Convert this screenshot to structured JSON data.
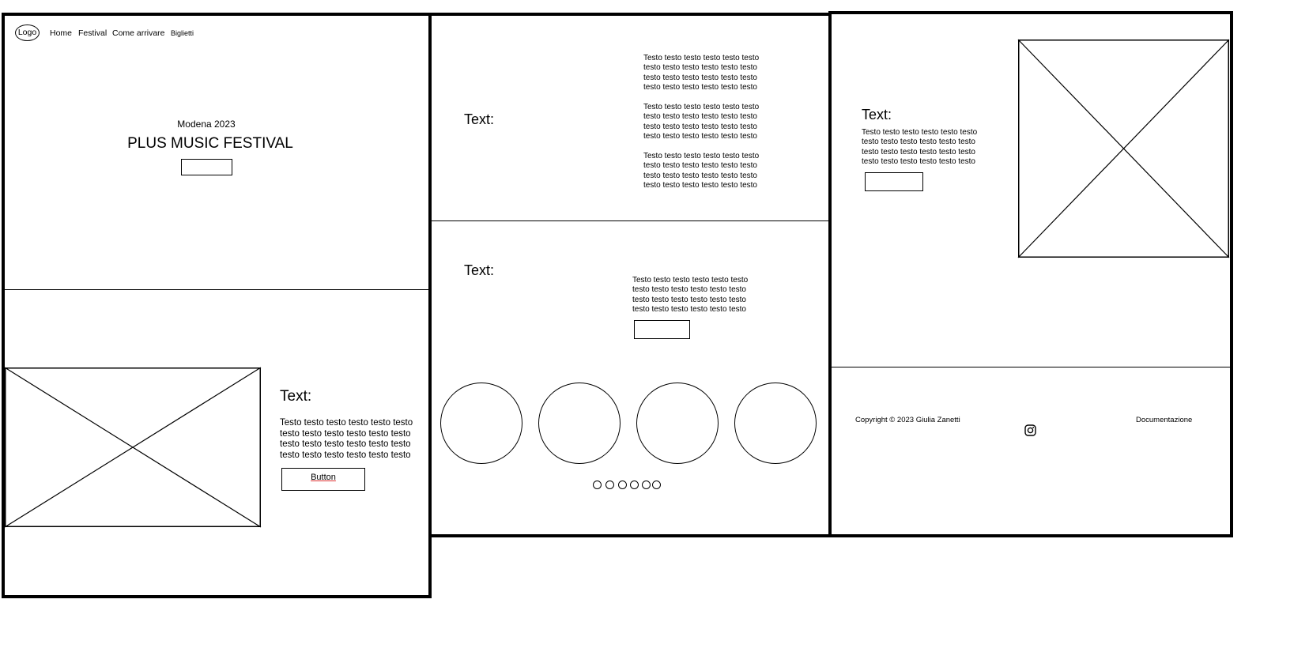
{
  "header": {
    "logo_label": "Logo",
    "nav": [
      "Home",
      "Festival",
      "Come arrivare",
      "Biglietti"
    ]
  },
  "hero": {
    "subtitle": "Modena 2023",
    "title": "PLUS MUSIC FESTIVAL"
  },
  "feature": {
    "heading": "Text:",
    "paragraph": "Testo testo testo testo testo testo\ntesto testo testo testo testo testo\ntesto testo testo testo testo testo\ntesto testo testo testo testo testo",
    "button_label": "Button"
  },
  "info": {
    "heading": "Text:",
    "paragraphs": [
      "Testo testo testo testo testo testo\ntesto testo testo testo testo testo\ntesto testo testo testo testo testo\ntesto testo testo testo testo testo",
      "Testo testo testo testo testo testo\ntesto testo testo testo testo testo\ntesto testo testo testo testo testo\ntesto testo testo testo testo testo",
      "Testo testo testo testo testo testo\ntesto testo testo testo testo testo\ntesto testo testo testo testo testo\ntesto testo testo testo testo testo"
    ]
  },
  "carousel": {
    "heading": "Text:",
    "paragraph": "Testo testo testo testo testo testo\ntesto testo testo testo testo testo\ntesto testo testo testo testo testo\ntesto testo testo testo testo testo",
    "dot_count": 6
  },
  "promo": {
    "heading": "Text:",
    "paragraph": "Testo testo testo testo testo testo\ntesto testo testo testo testo testo\ntesto testo testo testo testo testo\ntesto testo testo testo testo testo"
  },
  "footer": {
    "copyright": "Copyright © 2023 Giulia Zanetti",
    "documentation_link": "Documentazione",
    "social_icon": "instagram-icon"
  }
}
